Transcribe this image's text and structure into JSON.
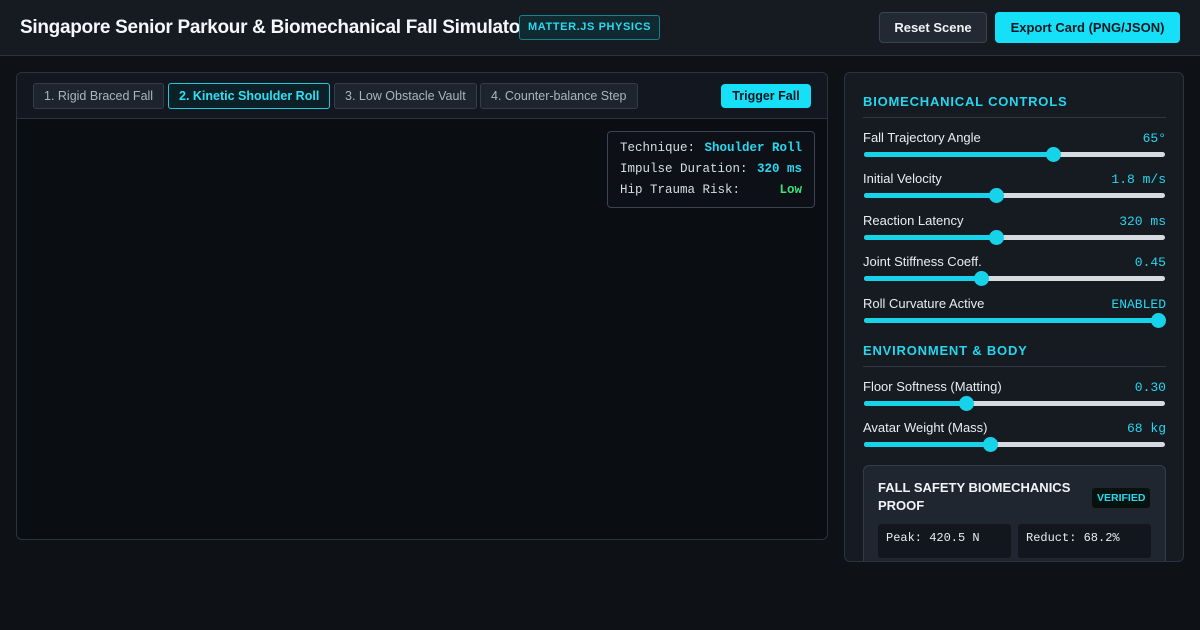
{
  "header": {
    "title": "Singapore Senior Parkour & Biomechanical Fall Simulator",
    "engine_badge": "MATTER.JS PHYSICS",
    "reset_label": "Reset Scene",
    "export_label": "Export Card (PNG/JSON)"
  },
  "simulation": {
    "tabs": [
      {
        "label": "1. Rigid Braced Fall",
        "active": false
      },
      {
        "label": "2. Kinetic Shoulder Roll",
        "active": true
      },
      {
        "label": "3. Low Obstacle Vault",
        "active": false
      },
      {
        "label": "4. Counter-balance Step",
        "active": false
      }
    ],
    "trigger_label": "Trigger Fall",
    "hud": {
      "technique_label": "Technique:",
      "technique_value": "Shoulder Roll",
      "impulse_label": "Impulse Duration:",
      "impulse_value": "320 ms",
      "risk_label": "Hip Trauma Risk:",
      "risk_value": "Low"
    }
  },
  "controls": {
    "biomech_heading": "BIOMECHANICAL CONTROLS",
    "env_heading": "ENVIRONMENT & BODY",
    "biomech": [
      {
        "label": "Fall Trajectory Angle",
        "value": "65°",
        "level": 0.63
      },
      {
        "label": "Initial Velocity",
        "value": "1.8 m/s",
        "level": 0.44
      },
      {
        "label": "Reaction Latency",
        "value": "320 ms",
        "level": 0.44
      },
      {
        "label": "Joint Stiffness Coeff.",
        "value": "0.45",
        "level": 0.39
      },
      {
        "label": "Roll Curvature Active",
        "value": "ENABLED",
        "level": 0.98
      }
    ],
    "environment": [
      {
        "label": "Floor Softness (Matting)",
        "value": "0.30",
        "level": 0.34
      },
      {
        "label": "Avatar Weight (Mass)",
        "value": "68 kg",
        "level": 0.42
      }
    ]
  },
  "proof": {
    "title": "FALL SAFETY BIOMECHANICS PROOF",
    "badge": "VERIFIED",
    "peak": "Peak: 420.5 N",
    "reduction": "Reduct: 68.2%"
  },
  "colors": {
    "accent": "#16e0f7",
    "success": "#3ae37a",
    "background": "#0e1216",
    "panel": "#161b22"
  }
}
